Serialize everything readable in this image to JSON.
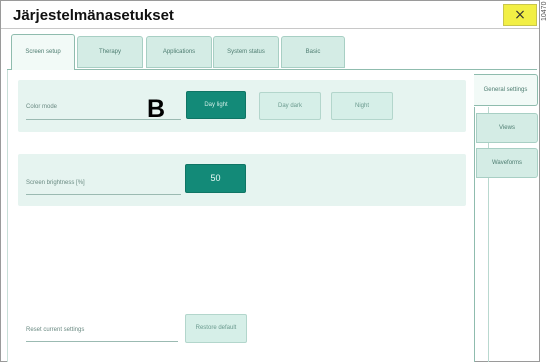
{
  "window": {
    "title": "Järjestelmänasetukset",
    "close_glyph": "×",
    "figure_code": "10470"
  },
  "tabs": [
    {
      "label": "Screen setup",
      "active": true
    },
    {
      "label": "Therapy",
      "active": false
    },
    {
      "label": "Applications",
      "active": false
    },
    {
      "label": "System status",
      "active": false
    },
    {
      "label": "Basic",
      "active": false
    }
  ],
  "side_tabs": [
    {
      "label": "General settings",
      "active": true
    },
    {
      "label": "Views",
      "active": false
    },
    {
      "label": "Waveforms",
      "active": false
    }
  ],
  "color_mode": {
    "label": "Color mode",
    "options": [
      "Day light",
      "Day dark",
      "Night"
    ],
    "selected": "Day light"
  },
  "marker": "B",
  "brightness": {
    "label": "Screen brightness [%]",
    "value": "50"
  },
  "reset": {
    "label": "Reset current settings",
    "button": "Restore default"
  },
  "colors": {
    "accent": "#138a78",
    "panel_bg": "#e6f4f0",
    "tab_bg": "#d4ece5",
    "close_bg": "#f2ef45"
  }
}
